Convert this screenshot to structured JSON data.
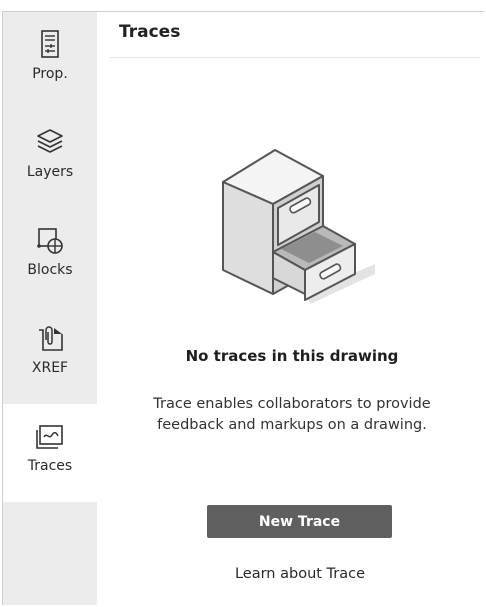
{
  "sidebar": {
    "items": [
      {
        "label": "Prop.",
        "icon": "properties-icon",
        "active": false
      },
      {
        "label": "Layers",
        "icon": "layers-icon",
        "active": false
      },
      {
        "label": "Blocks",
        "icon": "blocks-icon",
        "active": false
      },
      {
        "label": "XREF",
        "icon": "xref-icon",
        "active": false
      },
      {
        "label": "Traces",
        "icon": "traces-icon",
        "active": true
      }
    ]
  },
  "panel": {
    "title": "Traces",
    "empty_state": {
      "illustration": "file-cabinet-illustration",
      "heading": "No traces in this drawing",
      "description": "Trace enables collaborators to provide feedback and markups on a drawing."
    },
    "primary_button": "New Trace",
    "learn_link": "Learn about Trace"
  },
  "colors": {
    "sidebar_bg": "#ececec",
    "active_tab_bg": "#ffffff",
    "button_bg": "#5f5f5f",
    "button_text": "#ffffff"
  }
}
